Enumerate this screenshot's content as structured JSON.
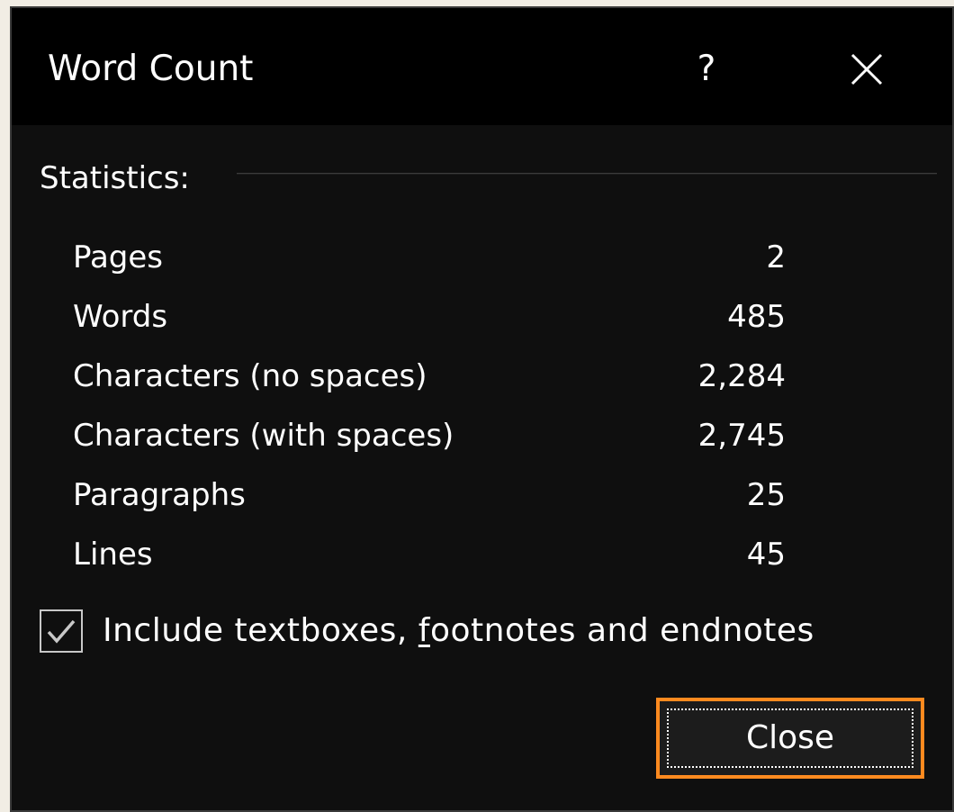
{
  "dialog": {
    "title": "Word Count",
    "help_label": "?",
    "close_icon": "close-icon"
  },
  "statistics": {
    "heading": "Statistics:",
    "rows": [
      {
        "label": "Pages",
        "value": "2"
      },
      {
        "label": "Words",
        "value": "485"
      },
      {
        "label": "Characters (no spaces)",
        "value": "2,284"
      },
      {
        "label": "Characters (with spaces)",
        "value": "2,745"
      },
      {
        "label": "Paragraphs",
        "value": "25"
      },
      {
        "label": "Lines",
        "value": "45"
      }
    ]
  },
  "include_notes": {
    "checked": true,
    "label_before": "Include textboxes, ",
    "label_accel": "f",
    "label_after": "ootnotes and endnotes"
  },
  "buttons": {
    "close_label": "Close"
  },
  "colors": {
    "background": "#0f0f0f",
    "titlebar": "#000000",
    "focus_outline": "#ff8a1f",
    "text": "#ffffff"
  }
}
